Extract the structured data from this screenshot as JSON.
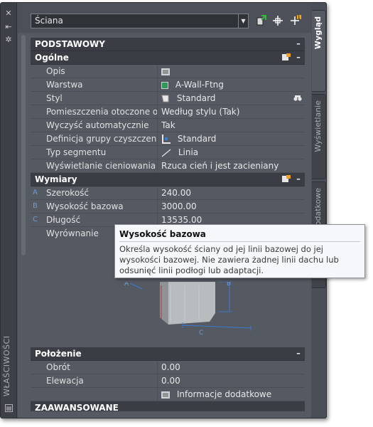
{
  "palette": {
    "vertical_title": "WŁAŚCIWOŚCI",
    "object_type": "Ściana"
  },
  "tabs": [
    "Wygląd",
    "Wyświetlanie",
    "Informacje dodatkowe"
  ],
  "sections": {
    "basic": {
      "title": "PODSTAWOWY"
    },
    "general": {
      "title": "Ogólne",
      "rows": [
        {
          "name": "Opis",
          "value": ""
        },
        {
          "name": "Warstwa",
          "value": "A-Wall-Ftng"
        },
        {
          "name": "Styl",
          "value": "Standard"
        },
        {
          "name": "Pomieszczenia otoczone o...",
          "value": "Według stylu (Tak)"
        },
        {
          "name": "Wyczyść automatycznie",
          "value": "Tak"
        },
        {
          "name": "Definicja grupy czyszczenia",
          "value": "Standard"
        },
        {
          "name": "Typ segmentu",
          "value": "Linia"
        },
        {
          "name": "Wyświetlanie cieniowania",
          "value": "Rzuca cień i jest zacieniany"
        }
      ]
    },
    "dimensions": {
      "title": "Wymiary",
      "rows": [
        {
          "mark": "A",
          "name": "Szerokość",
          "value": "240.00"
        },
        {
          "mark": "B",
          "name": "Wysokość bazowa",
          "value": "3000.00"
        },
        {
          "mark": "C",
          "name": "Długość",
          "value": "13535.00"
        },
        {
          "mark": "",
          "name": "Wyrównanie",
          "value": ""
        }
      ],
      "diagram_labels": {
        "a": "A",
        "b": "B",
        "c": "C"
      }
    },
    "position": {
      "title": "Położenie",
      "rows": [
        {
          "name": "Obrót",
          "value": "0.00"
        },
        {
          "name": "Elewacja",
          "value": "0.00"
        }
      ],
      "extra_info": "Informacje dodatkowe"
    },
    "advanced": {
      "title": "ZAAWANSOWANE"
    }
  },
  "tooltip": {
    "title": "Wysokość bazowa",
    "body": "Określa wysokość ściany od jej linii bazowej do jej wysokości bazowej. Nie zawiera żadnej linii dachu lub odsunięć linii podłogi lub adaptacji."
  },
  "colors": {
    "panel_bg": "#555962",
    "header_bg": "#3a3d43",
    "layer_swatch": "#2f9a5a",
    "dimension_mark": "#6c9cd8"
  },
  "icons": {
    "collapse": "minus-icon",
    "description": "text-editor-icon",
    "style": "wall-style-icon",
    "style_browse": "binoculars-icon",
    "cleanup_group": "cleanup-group-icon",
    "segment": "line-segment-icon"
  }
}
